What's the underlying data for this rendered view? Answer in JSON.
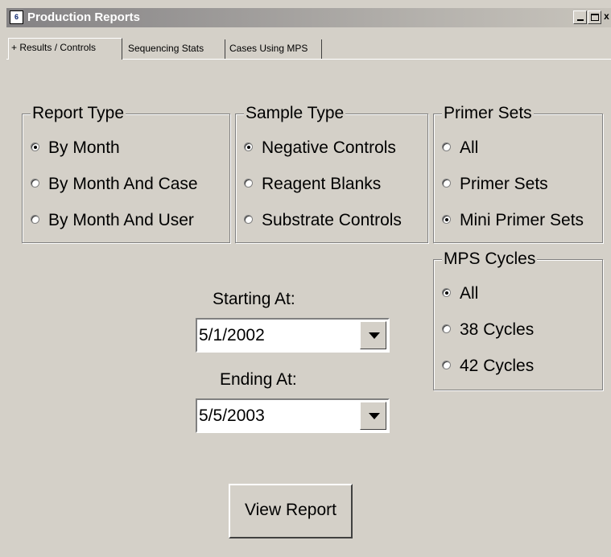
{
  "window": {
    "title": "Production Reports",
    "icon_label": "6",
    "close_glyph": "x"
  },
  "tabs": [
    {
      "label": "+ Results / Controls",
      "active": true
    },
    {
      "label": "Sequencing Stats",
      "active": false
    },
    {
      "label": "Cases Using MPS",
      "active": false
    }
  ],
  "report_type": {
    "title": "Report Type",
    "options": [
      {
        "label": "By Month",
        "checked": true
      },
      {
        "label": "By Month And Case",
        "checked": false
      },
      {
        "label": "By Month And User",
        "checked": false
      }
    ]
  },
  "sample_type": {
    "title": "Sample Type",
    "options": [
      {
        "label": "Negative Controls",
        "checked": true
      },
      {
        "label": "Reagent Blanks",
        "checked": false
      },
      {
        "label": "Substrate Controls",
        "checked": false
      }
    ]
  },
  "primer_sets": {
    "title": "Primer Sets",
    "options": [
      {
        "label": "All",
        "checked": false
      },
      {
        "label": "Primer Sets",
        "checked": false
      },
      {
        "label": "Mini Primer Sets",
        "checked": true
      }
    ]
  },
  "mps_cycles": {
    "title": "MPS Cycles",
    "options": [
      {
        "label": "All",
        "checked": true
      },
      {
        "label": "38 Cycles",
        "checked": false
      },
      {
        "label": "42 Cycles",
        "checked": false
      }
    ]
  },
  "starting": {
    "label": "Starting At:",
    "value": "5/1/2002"
  },
  "ending": {
    "label": "Ending At:",
    "value": "5/5/2003"
  },
  "view_button": {
    "label": "View Report"
  },
  "colors": {
    "face": "#d4d0c8",
    "title_gradient_start": "#848284"
  }
}
